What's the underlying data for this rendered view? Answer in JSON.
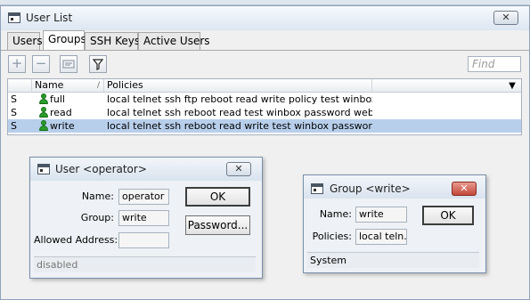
{
  "main_window": {
    "title": "User List",
    "close_symbol": "✕",
    "tabs": [
      {
        "label": "Users",
        "active": false
      },
      {
        "label": "Groups",
        "active": true
      },
      {
        "label": "SSH Keys",
        "active": false
      },
      {
        "label": "Active Users",
        "active": false
      }
    ],
    "toolbar": {
      "add_icon": "plus-icon",
      "add_glyph": "+",
      "remove_icon": "minus-icon",
      "remove_glyph": "−",
      "comment_icon": "comment-icon",
      "filter_icon": "filter-icon",
      "find_placeholder": "Find"
    },
    "table": {
      "columns": [
        "Name",
        "Policies"
      ],
      "sort_indicator": "/",
      "dropdown_glyph": "▼",
      "rows": [
        {
          "flag": "S",
          "name": "full",
          "policies": "local telnet ssh ftp reboot read write policy test winbox passw...",
          "selected": false
        },
        {
          "flag": "S",
          "name": "read",
          "policies": "local telnet ssh reboot read test winbox password web sniff s...",
          "selected": false
        },
        {
          "flag": "S",
          "name": "write",
          "policies": "local telnet ssh reboot read write test winbox password web ...",
          "selected": true
        }
      ]
    }
  },
  "user_dialog": {
    "title": "User <operator>",
    "close_symbol": "✕",
    "fields": {
      "name_label": "Name:",
      "name_value": "operator",
      "group_label": "Group:",
      "group_value": "write",
      "allowed_label": "Allowed Address:",
      "allowed_value": ""
    },
    "buttons": {
      "ok": "OK",
      "password": "Password..."
    },
    "status": "disabled"
  },
  "group_dialog": {
    "title": "Group <write>",
    "close_symbol": "✕",
    "fields": {
      "name_label": "Name:",
      "name_value": "write",
      "policies_label": "Policies:",
      "policies_value": "local teln..."
    },
    "buttons": {
      "ok": "OK"
    },
    "status": "System"
  },
  "colors": {
    "selection": "#b8cfec",
    "close_red": "#c2483a",
    "user_icon_green": "#2a9d2a"
  }
}
